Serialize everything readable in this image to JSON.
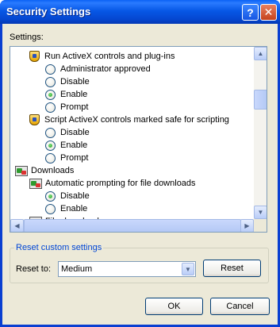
{
  "window": {
    "title": "Security Settings"
  },
  "titlebar": {
    "help_glyph": "?",
    "close_glyph": "✕"
  },
  "settings": {
    "label": "Settings:"
  },
  "tree": [
    {
      "kind": "item",
      "icon": "shield-icon",
      "label": "Run ActiveX controls and plug-ins"
    },
    {
      "kind": "radio",
      "label": "Administrator approved",
      "checked": false
    },
    {
      "kind": "radio",
      "label": "Disable",
      "checked": false
    },
    {
      "kind": "radio",
      "label": "Enable",
      "checked": true
    },
    {
      "kind": "radio",
      "label": "Prompt",
      "checked": false
    },
    {
      "kind": "item",
      "icon": "shield-icon",
      "label": "Script ActiveX controls marked safe for scripting"
    },
    {
      "kind": "radio",
      "label": "Disable",
      "checked": false
    },
    {
      "kind": "radio",
      "label": "Enable",
      "checked": true
    },
    {
      "kind": "radio",
      "label": "Prompt",
      "checked": false
    },
    {
      "kind": "category",
      "icon": "downloads-icon",
      "label": "Downloads"
    },
    {
      "kind": "item",
      "icon": "downloads-icon",
      "label": "Automatic prompting for file downloads"
    },
    {
      "kind": "radio",
      "label": "Disable",
      "checked": true
    },
    {
      "kind": "radio",
      "label": "Enable",
      "checked": false
    },
    {
      "kind": "item",
      "icon": "downloads-icon",
      "label": "File download"
    }
  ],
  "reset_group": {
    "title": "Reset custom settings",
    "reset_to_label": "Reset to:",
    "selected": "Medium",
    "reset_button": "Reset"
  },
  "buttons": {
    "ok": "OK",
    "cancel": "Cancel"
  }
}
